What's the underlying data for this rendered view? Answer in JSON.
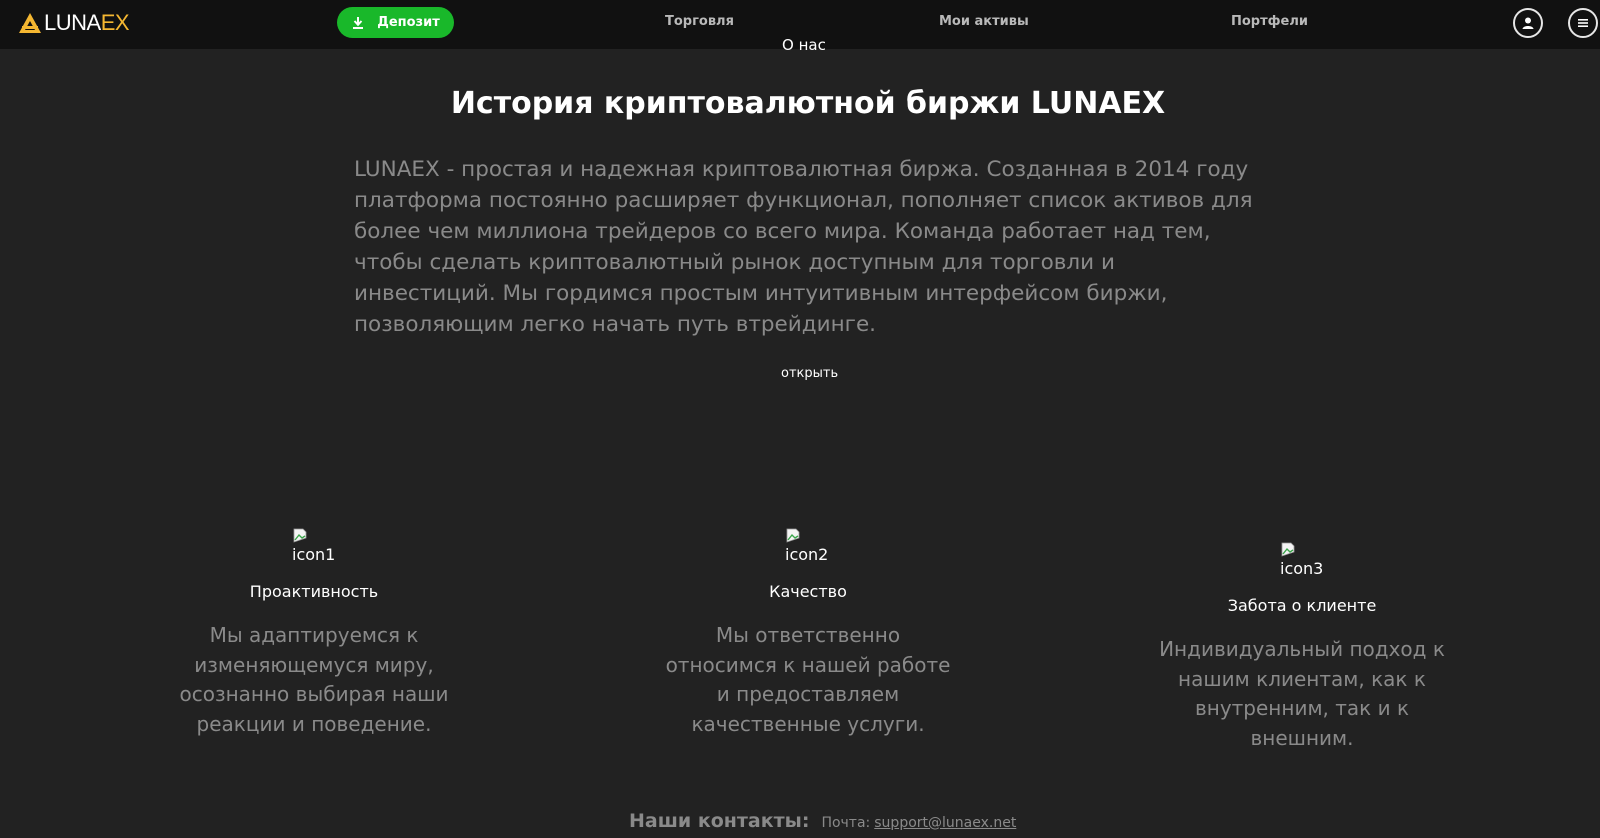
{
  "header": {
    "logo": {
      "part1": "LUNA",
      "part2": "EX"
    },
    "deposit_label": "Депозит",
    "nav": {
      "trade": "Торговля",
      "assets": "Мои активы",
      "portfolios": "Портфели"
    },
    "icons": [
      "download-icon",
      "user-icon",
      "menu-icon"
    ]
  },
  "about_heading_cut": "О нас",
  "title": "История криптовалютной биржи LUNAEX",
  "history_text": "LUNAEX - простая и надежная криптовалютная биржа. Созданная в 2014 году платформа постоянно расширяет функционал, пополняет список активов для более чем миллиона трейдеров со всего мира. Команда работает над тем, чтобы сделать криптовалютный рынок доступным для торговли и инвестиций. Мы гордимся простым интуитивным интерфейсом биржи, позволяющим легко начать путь втрейдинге.",
  "open_link": "открыть",
  "features": [
    {
      "icon_alt": "icon1",
      "title": "Проактивность",
      "text": "Мы адаптируемся к изменяющемуся миру, осознанно выбирая наши реакции и поведение."
    },
    {
      "icon_alt": "icon2",
      "title": "Качество",
      "text": "Мы ответственно относимся к нашей работе и предоставляем качественные услуги."
    },
    {
      "icon_alt": "icon3",
      "title": "Забота о клиенте",
      "text": "Индивидуальный подход к нашим клиентам, как к внутренним, так и к внешним."
    }
  ],
  "contacts": {
    "title": "Наши контакты:",
    "mail_label": "Почта:",
    "email": "support@lunaex.net"
  },
  "colors": {
    "background": "#222222",
    "header": "#111111",
    "accent_green": "#19b82a",
    "logo_gold": "#f5b731",
    "muted_text": "#8a8a8a"
  }
}
